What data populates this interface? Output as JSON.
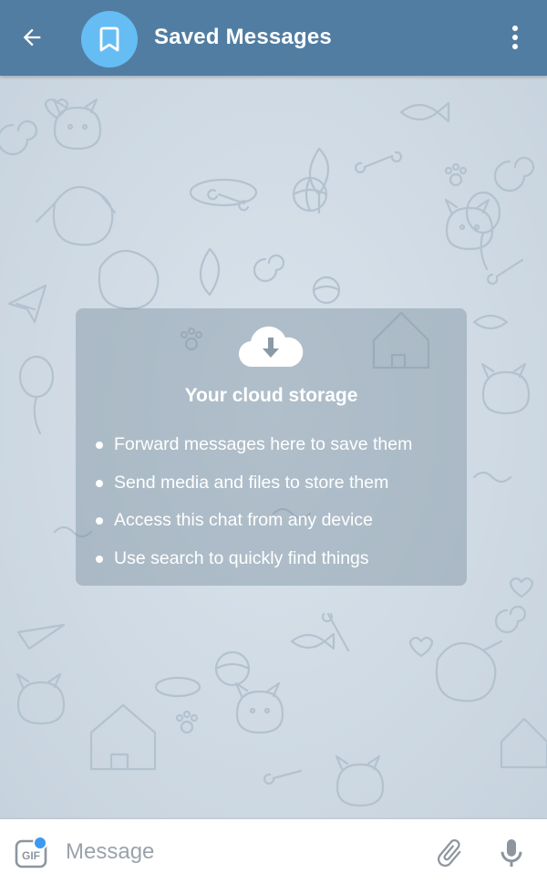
{
  "header": {
    "back_icon": "arrow-left-icon",
    "avatar_icon": "bookmark-icon",
    "title": "Saved Messages",
    "menu_icon": "more-vertical-icon"
  },
  "cloud_card": {
    "icon": "cloud-download-icon",
    "title": "Your cloud storage",
    "features": [
      "Forward messages here to save them",
      "Send media and files to store them",
      "Access this chat from any device",
      "Use search to quickly find things"
    ]
  },
  "input_bar": {
    "gif_label": "GIF",
    "placeholder": "Message",
    "attach_icon": "paperclip-icon",
    "mic_icon": "microphone-icon"
  },
  "colors": {
    "header": "#517da2",
    "avatar": "#65bdf4",
    "chat_background": "#cfdae4",
    "badge": "#3b9aef"
  }
}
